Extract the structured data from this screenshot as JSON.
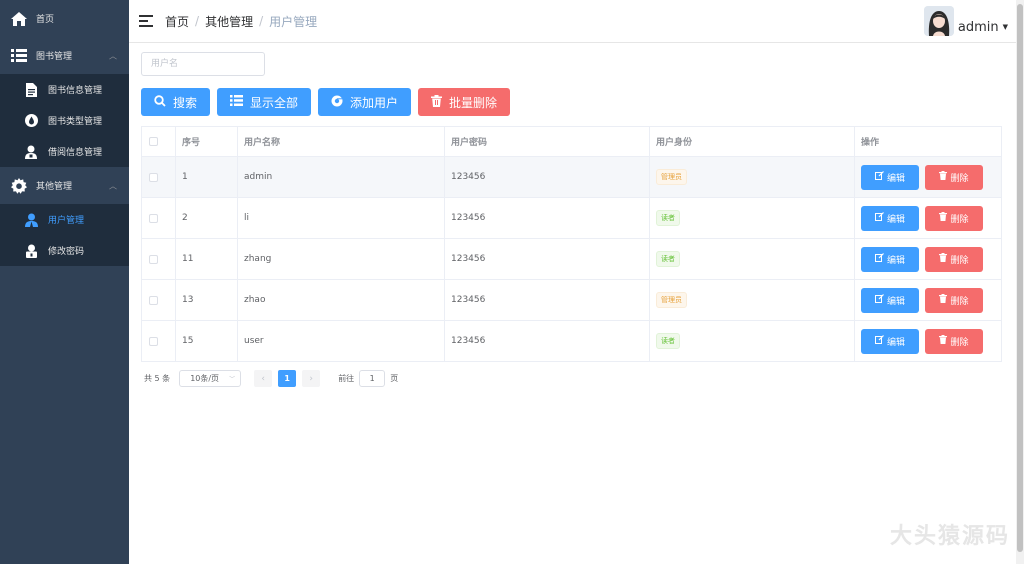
{
  "sidebar": {
    "home": "首页",
    "book_mgmt": "图书管理",
    "book_items": [
      "图书信息管理",
      "图书类型管理",
      "借阅信息管理"
    ],
    "other_mgmt": "其他管理",
    "other_items": [
      "用户管理",
      "修改密码"
    ]
  },
  "header": {
    "breadcrumb": [
      "首页",
      "其他管理",
      "用户管理"
    ],
    "username": "admin"
  },
  "search": {
    "placeholder": "用户名"
  },
  "toolbar": {
    "search": "搜索",
    "show_all": "显示全部",
    "add_user": "添加用户",
    "batch_delete": "批量删除"
  },
  "table": {
    "headers": [
      "序号",
      "用户名称",
      "用户密码",
      "用户身份",
      "操作"
    ],
    "edit_label": "编辑",
    "delete_label": "删除",
    "rows": [
      {
        "id": "1",
        "name": "admin",
        "password": "123456",
        "role": "管理员"
      },
      {
        "id": "2",
        "name": "li",
        "password": "123456",
        "role": "读者"
      },
      {
        "id": "11",
        "name": "zhang",
        "password": "123456",
        "role": "读者"
      },
      {
        "id": "13",
        "name": "zhao",
        "password": "123456",
        "role": "管理员"
      },
      {
        "id": "15",
        "name": "user",
        "password": "123456",
        "role": "读者"
      }
    ]
  },
  "pagination": {
    "total": "共 5 条",
    "page_size": "10条/页",
    "current_page": "1",
    "goto_prefix": "前往",
    "goto_value": "1",
    "goto_suffix": "页"
  },
  "watermark": "大头猿源码",
  "colors": {
    "primary": "#409eff",
    "danger": "#f56c6c",
    "sidebar": "#304156"
  }
}
